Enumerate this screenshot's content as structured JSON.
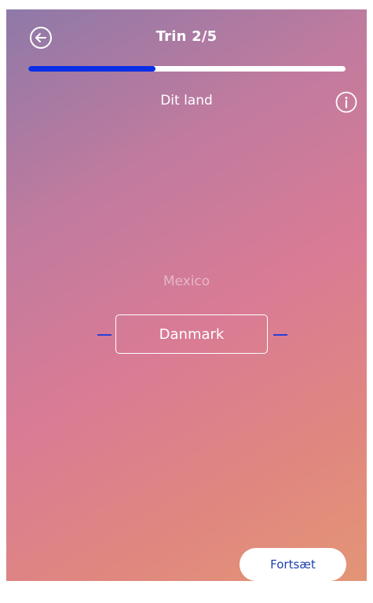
{
  "header": {
    "title": "Trin 2/5",
    "back_icon": "arrow-left-circle-icon",
    "progress_fraction": 0.4
  },
  "question": {
    "label": "Dit land",
    "info_icon": "info-circle-icon"
  },
  "picker": {
    "previous_option": "Mexico",
    "selected_option": "Danmark"
  },
  "footer": {
    "continue_label": "Fortsæt"
  },
  "colors": {
    "progress_fill": "#0a2ee6",
    "button_text": "#1e3fae"
  }
}
